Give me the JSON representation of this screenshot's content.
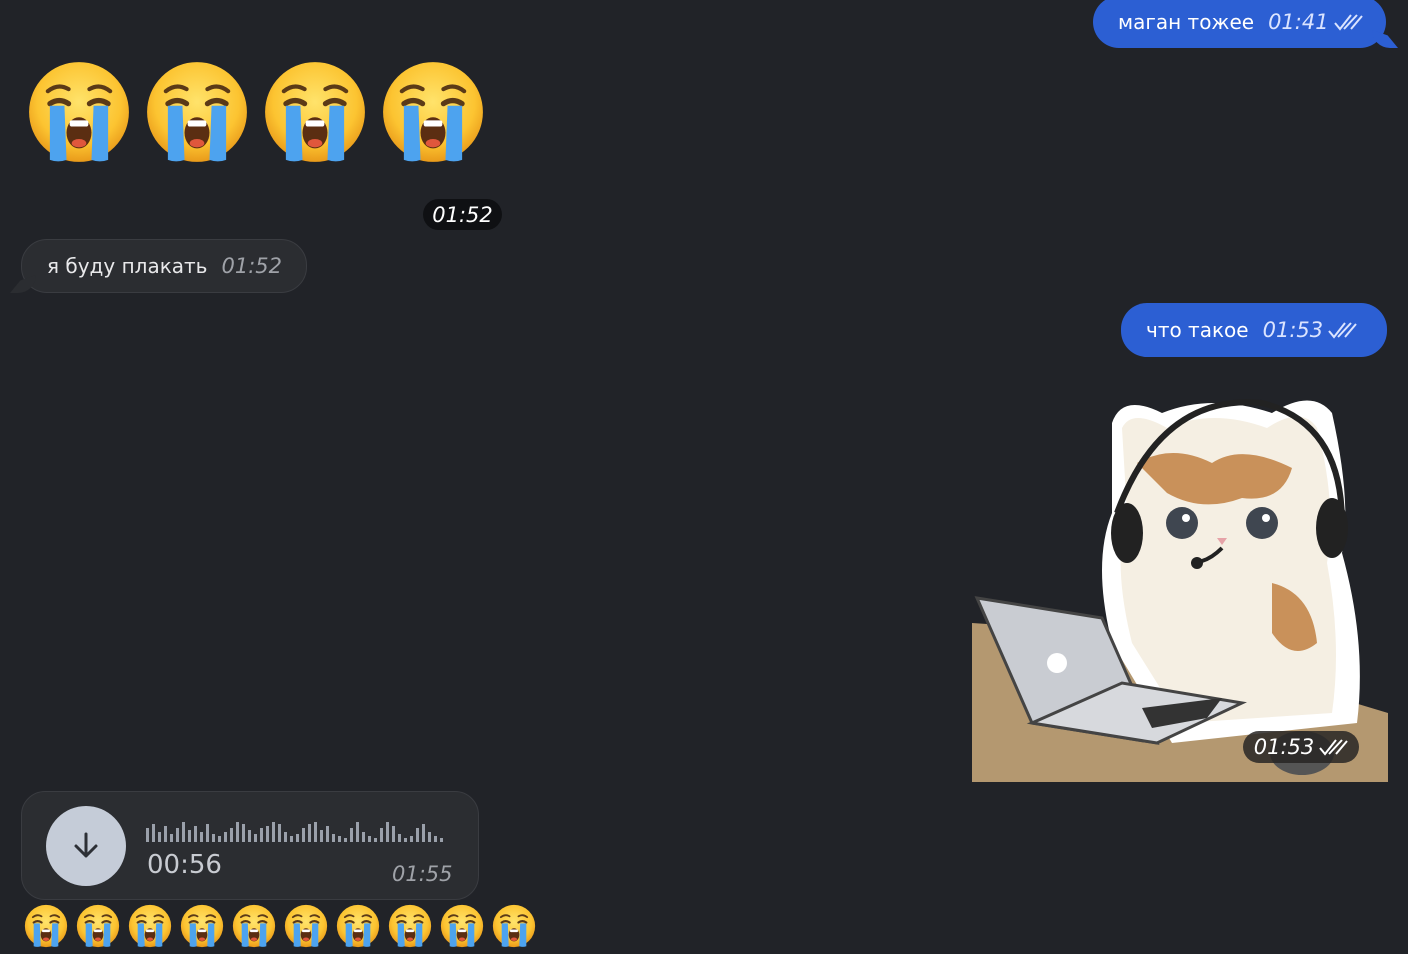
{
  "messages": {
    "out1": {
      "text": "маган тожее",
      "time": "01:41"
    },
    "in_emoji_count": 4,
    "time_pill": "01:52",
    "in1": {
      "text": "я буду плакать",
      "time": "01:52"
    },
    "out2": {
      "text": "что такое",
      "time": "01:53"
    },
    "sticker": {
      "time": "01:53",
      "icon": "cat-laptop-headset-sticker"
    },
    "voice": {
      "duration": "00:56",
      "time": "01:55",
      "icon": "download-arrow-icon"
    },
    "emoji_row_count": 10
  },
  "colors": {
    "background": "#212328",
    "outgoing_bubble": "#2c5fd3",
    "incoming_bubble": "#2b2d31"
  }
}
